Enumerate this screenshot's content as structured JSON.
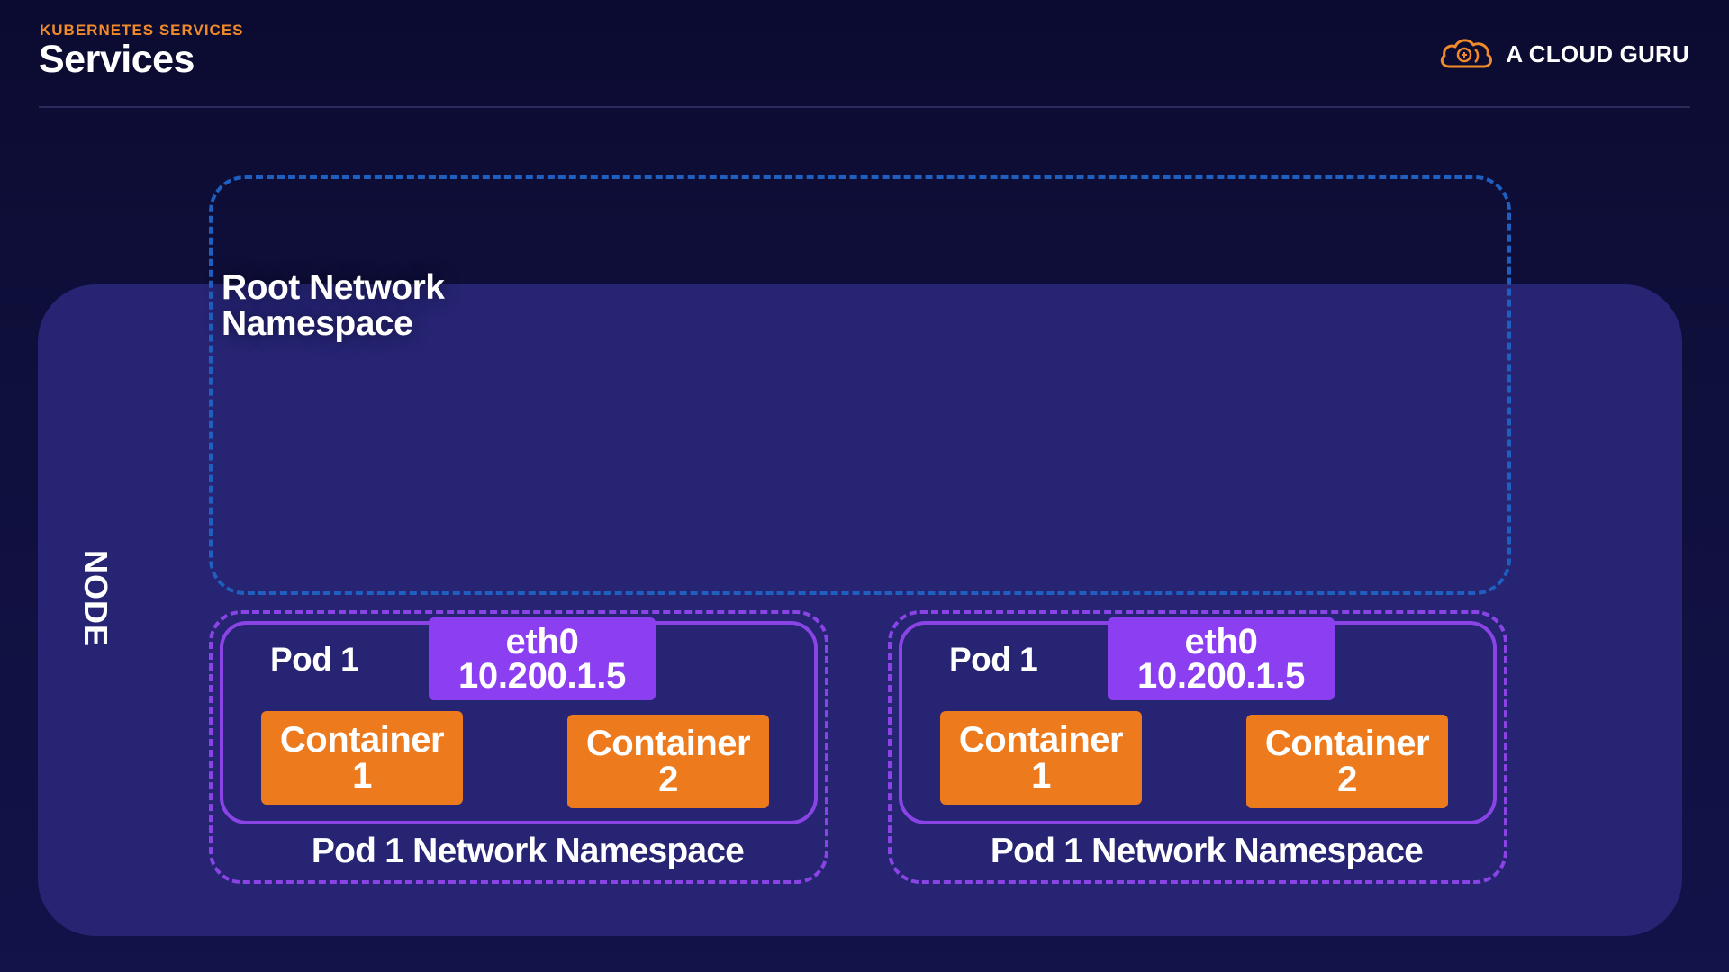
{
  "header": {
    "kicker": "KUBERNETES SERVICES",
    "title": "Services",
    "brand_name": "A CLOUD GURU",
    "brand_icon": "cloud-logo-icon"
  },
  "diagram": {
    "node_label": "NODE",
    "root_namespace": {
      "line1": "Root Network",
      "line2": "Namespace"
    },
    "pods": [
      {
        "pod_label": "Pod 1",
        "interface_name": "eth0",
        "ip": "10.200.1.5",
        "containers": [
          {
            "line1": "Container",
            "line2": "1"
          },
          {
            "line1": "Container",
            "line2": "2"
          }
        ],
        "namespace_label": "Pod 1 Network Namespace"
      },
      {
        "pod_label": "Pod 1",
        "interface_name": "eth0",
        "ip": "10.200.1.5",
        "containers": [
          {
            "line1": "Container",
            "line2": "1"
          },
          {
            "line1": "Container",
            "line2": "2"
          }
        ],
        "namespace_label": "Pod 1 Network Namespace"
      }
    ]
  },
  "colors": {
    "background": "#0b0b31",
    "node_panel": "#262473",
    "root_namespace_border": "#1f5fbf",
    "pod_border": "#8a44e6",
    "interface_fill": "#8b3ff0",
    "container_fill": "#ee7a1e",
    "accent": "#f08a2a"
  }
}
